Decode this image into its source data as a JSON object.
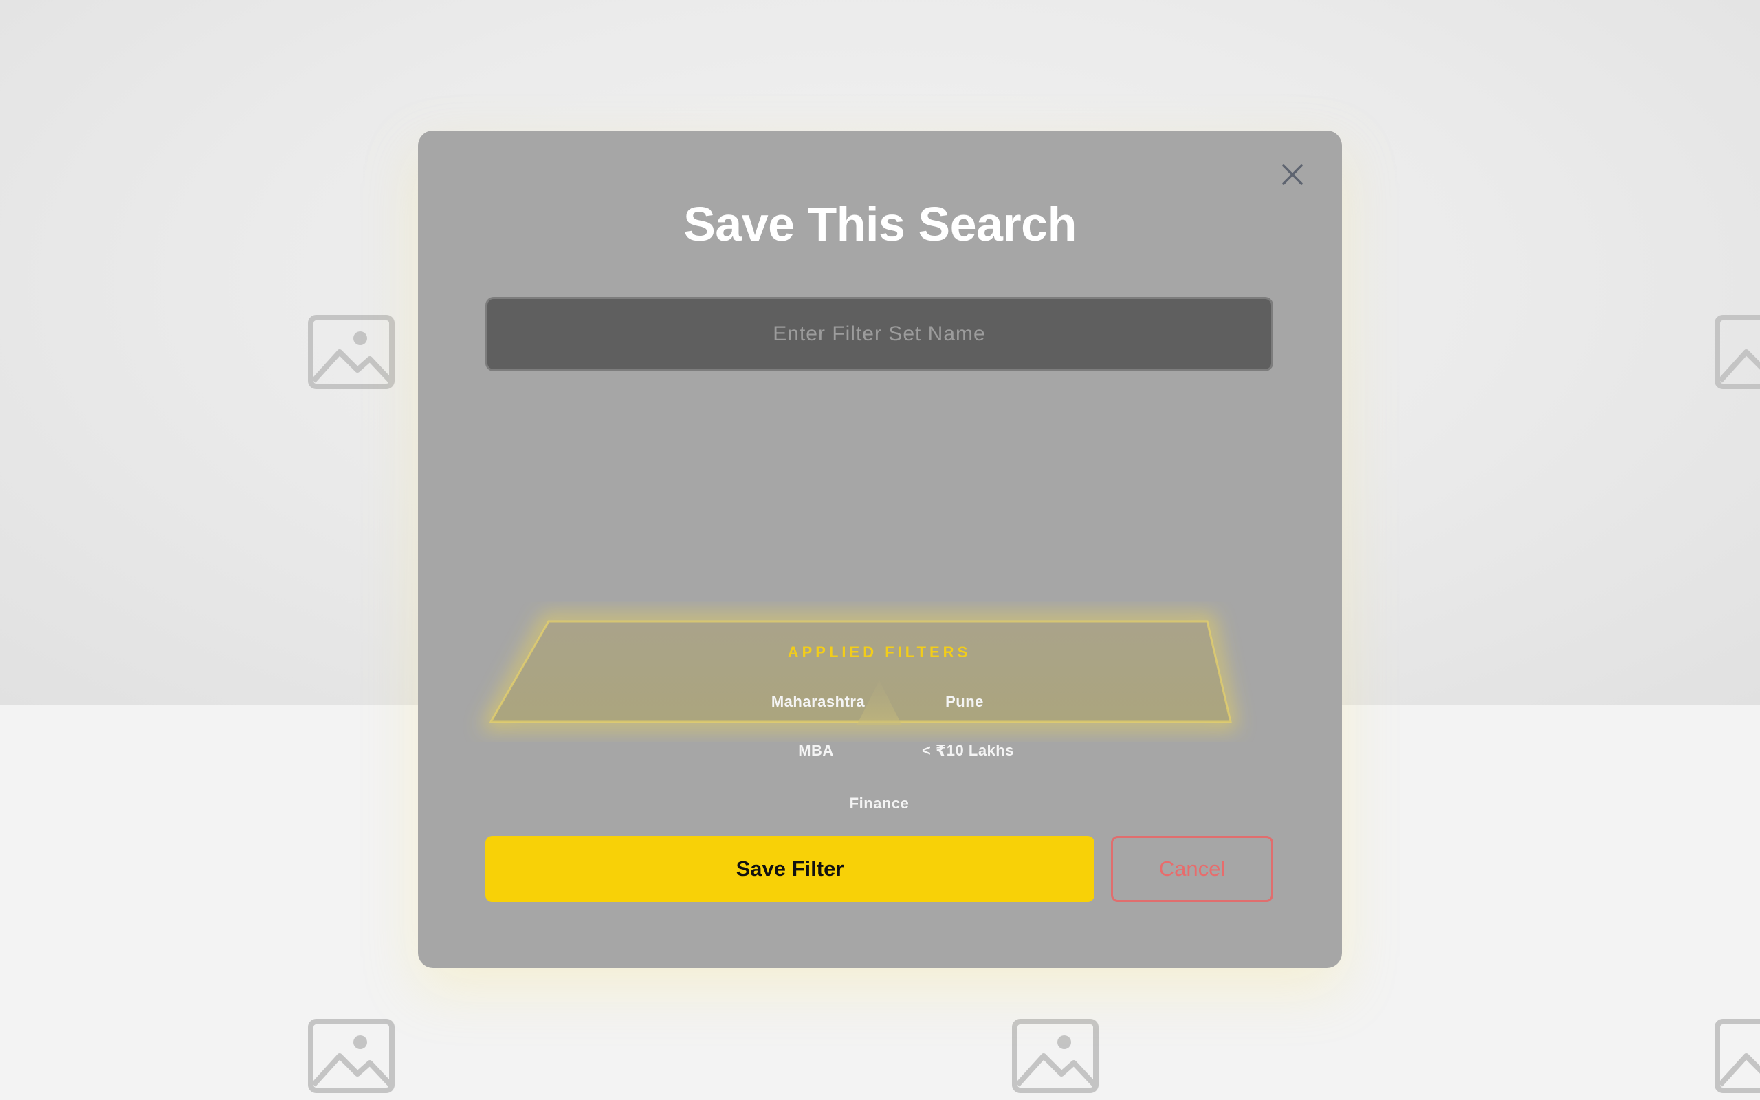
{
  "modal": {
    "title": "Save This Search",
    "close_icon": "close-icon",
    "name_input": {
      "placeholder": "Enter Filter Set Name",
      "value": ""
    },
    "applied_filters": {
      "heading": "APPLIED FILTERS",
      "chips": [
        "Maharashtra",
        "Pune",
        "MBA",
        "< ₹10 Lakhs",
        "Finance"
      ]
    },
    "save_label": "Save Filter",
    "cancel_label": "Cancel"
  },
  "background": {
    "image_placeholder_icon": "image-placeholder-icon"
  },
  "colors": {
    "accent": "#f8d107",
    "modal_bg": "#a6a6a6",
    "cancel": "#e06e6e",
    "filters_heading": "#f2cd1a"
  }
}
